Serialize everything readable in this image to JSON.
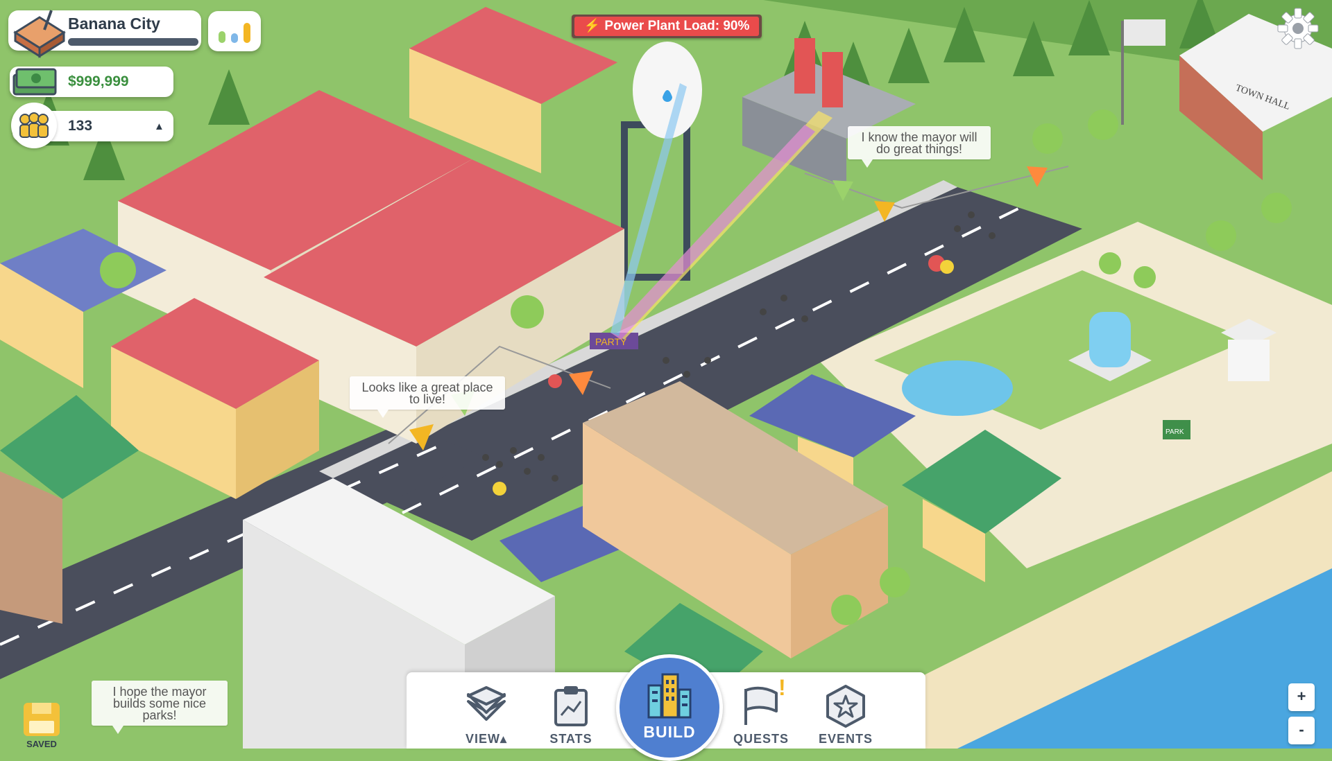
{
  "city": {
    "name": "Banana City",
    "icon": "sandbox-city-icon"
  },
  "resources": {
    "money": "$999,999",
    "population": "133",
    "population_trend": "▲"
  },
  "alert": {
    "text": "Power Plant Load: 90%",
    "icon": "lightning-icon"
  },
  "utility_meter": {
    "icon": "utility-meter-icon",
    "levels": [
      0.5,
      0.4,
      0.85
    ],
    "colors": [
      "#9bd26b",
      "#7fb7e8",
      "#f3b623"
    ]
  },
  "speech_bubbles": [
    "I know the mayor will do great things!",
    "Looks like a great place to live!",
    "I hope the mayor builds some nice parks!"
  ],
  "toolbar": {
    "view": "VIEW",
    "view_arrow": "▴",
    "stats": "STATS",
    "build": "BUILD",
    "quests": "QUESTS",
    "quests_badge": "!",
    "events": "EVENTS"
  },
  "zoom": {
    "plus": "+",
    "minus": "-"
  },
  "save": {
    "label": "SAVED"
  },
  "signs": {
    "party": "PARTY",
    "town_hall": "TOWN HALL",
    "park": "PARK"
  },
  "colors": {
    "accent": "#4f7fd0",
    "alert": "#ea4b4b",
    "money": "#3a8f3e",
    "gold": "#f3b623"
  }
}
